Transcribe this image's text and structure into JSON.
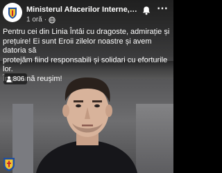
{
  "post": {
    "page_name": "Ministerul Afacerilor Interne, Roma...",
    "time": "1 oră",
    "separator": "·",
    "caption": "Pentru cei din Linia Întâi cu dragoste, admirație și\nprețuire! Ei sunt Eroii zilelor noastre și avem datoria să\nprotejăm fiind responsabili și solidari cu eforturile lor.\nÎmpreună reușim!",
    "more_label": "⋯"
  },
  "live": {
    "viewer_count": "806"
  },
  "icons": {
    "avatar": "ministry-crest-icon",
    "privacy": "globe-icon",
    "notifications": "bell-icon",
    "viewers": "person-icon",
    "watermark": "crest-watermark-icon"
  },
  "colors": {
    "text": "#ffffff",
    "secondary_text": "#dddddd",
    "badge_background": "rgba(0,0,0,0.55)"
  }
}
